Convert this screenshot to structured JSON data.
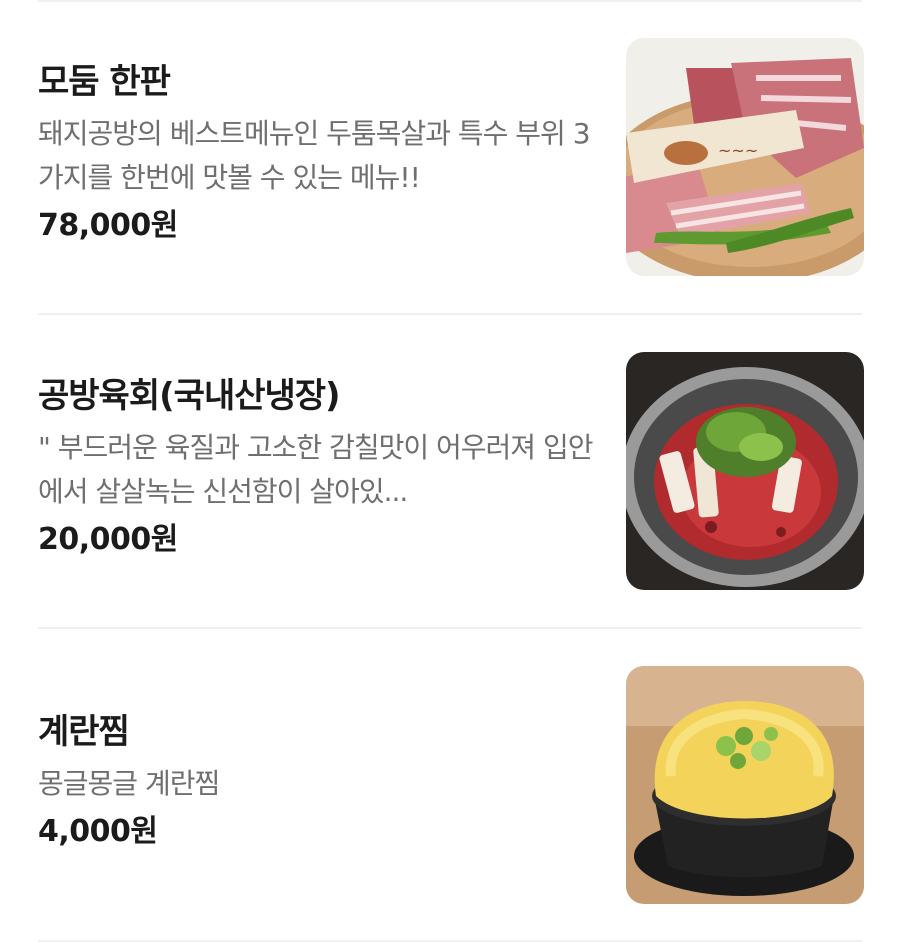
{
  "menu": {
    "items": [
      {
        "name": "모둠 한판",
        "description": "돼지공방의 베스트메뉴인 두툼목살과 특수 부위 3가지를 한번에 맛볼 수 있는 메뉴!!",
        "price": "78,000원",
        "image_icon": "pork-platter-photo"
      },
      {
        "name": "공방육회(국내산냉장)",
        "description": "\" 부드러운 육질과 고소한 감칠맛이 어우러져 입안에서 살살녹는 신선함이 살아있...",
        "price": "20,000원",
        "image_icon": "beef-tartare-photo"
      },
      {
        "name": "계란찜",
        "description": "몽글몽글 계란찜",
        "price": "4,000원",
        "image_icon": "steamed-egg-photo"
      }
    ]
  },
  "colors": {
    "text_primary": "#1b1b1b",
    "text_secondary": "#6f6f6f",
    "divider": "#f0f0f0"
  }
}
